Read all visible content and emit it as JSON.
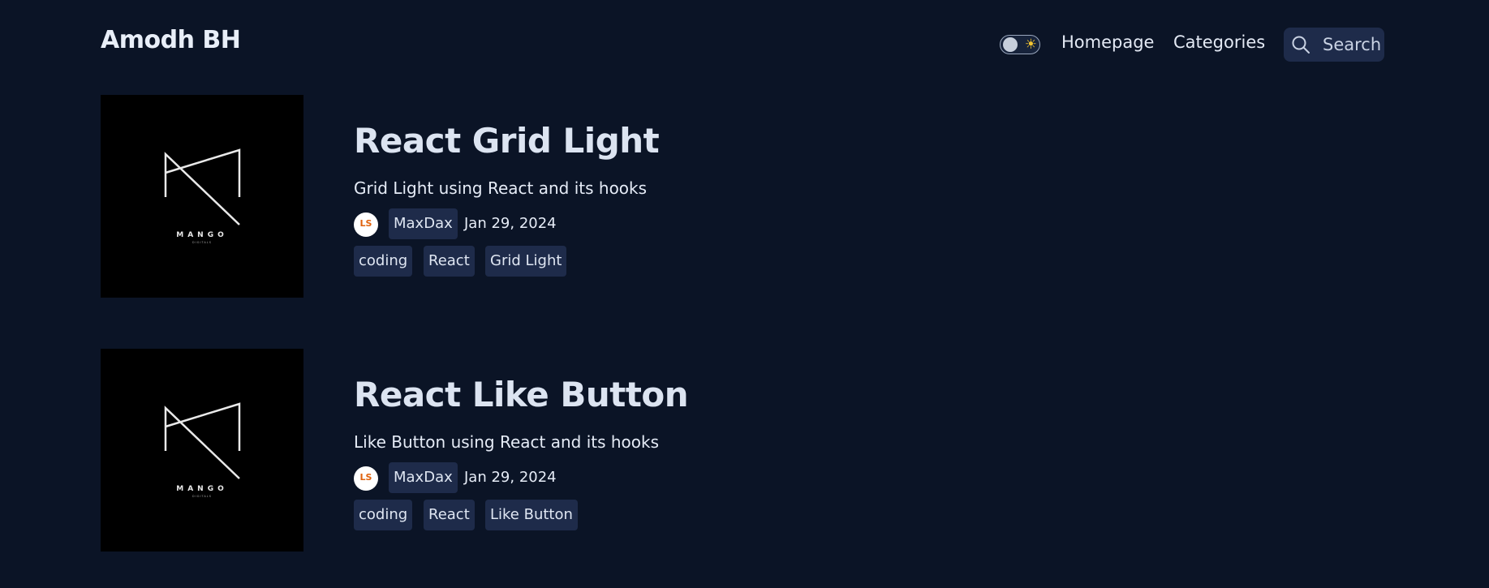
{
  "header": {
    "brand": "Amodh BH",
    "theme_toggle_icon": "sun-icon",
    "nav": {
      "homepage": "Homepage",
      "categories": "Categories"
    },
    "search": {
      "label": "Search",
      "icon": "search-icon"
    }
  },
  "posts": [
    {
      "thumbnail_icon": "mango-logo",
      "title": "React Grid Light",
      "description": "Grid Light using React and its hooks",
      "author": "MaxDax",
      "date": "Jan 29, 2024",
      "tags": [
        "coding",
        "React",
        "Grid Light"
      ]
    },
    {
      "thumbnail_icon": "mango-logo",
      "title": "React Like Button",
      "description": "Like Button using React and its hooks",
      "author": "MaxDax",
      "date": "Jan 29, 2024",
      "tags": [
        "coding",
        "React",
        "Like Button"
      ]
    }
  ],
  "logo_text": {
    "main": "MANGO",
    "sub": "DIGITALS"
  },
  "avatar_text": "LS",
  "colors": {
    "background": "#0b1426",
    "chip": "#1e2b4a",
    "text": "#e6ecf7",
    "sun": "#f4c531"
  }
}
